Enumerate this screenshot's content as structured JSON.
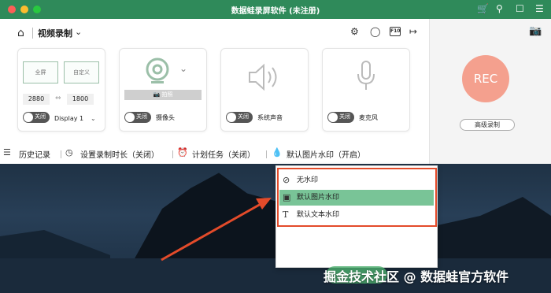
{
  "window": {
    "title": "数据蛙录屏软件 (未注册)"
  },
  "toolbar": {
    "mode_label": "视频录制"
  },
  "screen_card": {
    "fullscreen_label": "全屏",
    "custom_label": "自定义",
    "width": "2880",
    "height": "1800",
    "toggle_label": "关闭",
    "display_label": "Display 1"
  },
  "webcam_card": {
    "photo_label": "拍照",
    "toggle_label": "关闭",
    "label": "摄像头"
  },
  "system_audio_card": {
    "toggle_label": "关闭",
    "label": "系统声音"
  },
  "mic_card": {
    "toggle_label": "关闭",
    "label": "麦克风"
  },
  "rec": {
    "label": "REC",
    "advanced_label": "高级录制"
  },
  "bottombar": {
    "history": "历史记录",
    "duration": "设置录制时长（关闭）",
    "schedule": "计划任务（关闭）",
    "watermark": "默认图片水印（开启）"
  },
  "watermark_menu": {
    "items": [
      {
        "label": "无水印",
        "icon": "no-symbol-icon"
      },
      {
        "label": "默认图片水印",
        "icon": "image-icon"
      },
      {
        "label": "默认文本水印",
        "icon": "text-icon"
      }
    ]
  },
  "overlay_text": "掘金技术社区 @ 数据蛙官方软件",
  "colors": {
    "titlebar": "#2f8a5a",
    "rec": "#f4a08e",
    "highlight_frame": "#e34b2a",
    "menu_selected": "#79c497"
  }
}
